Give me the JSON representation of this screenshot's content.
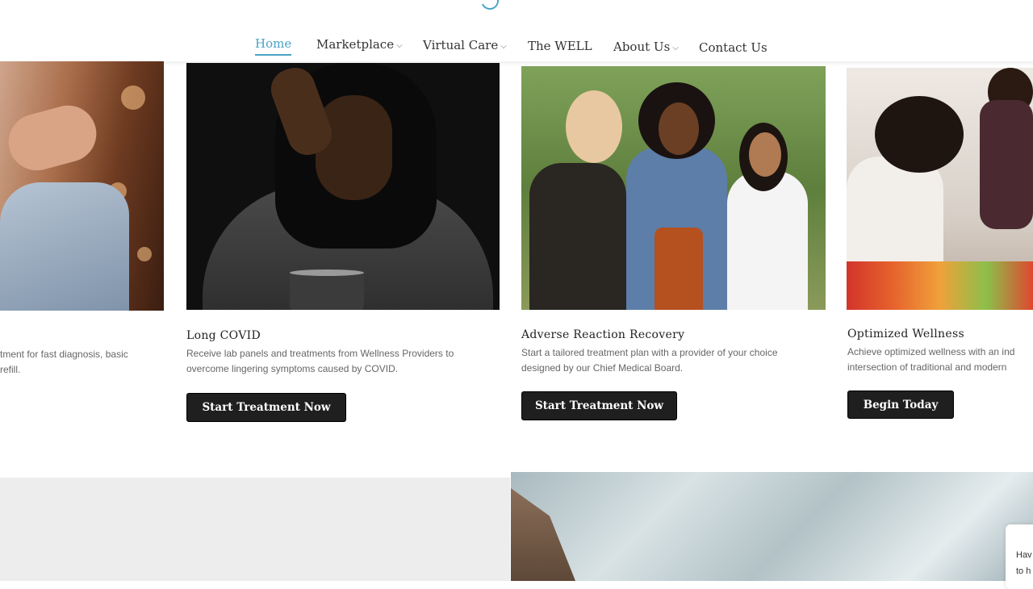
{
  "nav": {
    "items": [
      {
        "label": "Home",
        "active": true,
        "dropdown": false
      },
      {
        "label": "Marketplace",
        "dropdown": true
      },
      {
        "label": "Virtual Care",
        "dropdown": true
      },
      {
        "label": "The WELL",
        "dropdown": false
      },
      {
        "label": "About Us",
        "dropdown": true
      },
      {
        "label": "Contact Us",
        "dropdown": false
      }
    ],
    "accent_color": "#4aa3c4"
  },
  "cards": [
    {
      "title": "",
      "desc_line1": "tment for fast diagnosis, basic",
      "desc_line2": "refill."
    },
    {
      "title": "Long COVID",
      "desc_line1": "Receive lab panels and treatments from Wellness Providers to",
      "desc_line2": "overcome lingering symptoms caused by COVID.",
      "button": "Start Treatment Now"
    },
    {
      "title": "Adverse Reaction Recovery",
      "desc_line1": "Start a tailored treatment plan with a provider of your choice",
      "desc_line2": "designed by our Chief Medical Board.",
      "button": "Start Treatment Now"
    },
    {
      "title": "Optimized Wellness",
      "desc_line1": "Achieve optimized wellness with an ind",
      "desc_line2": "intersection of traditional and modern",
      "button": "Begin Today"
    }
  ],
  "chat": {
    "line1": "Hav",
    "line2": "to h"
  }
}
